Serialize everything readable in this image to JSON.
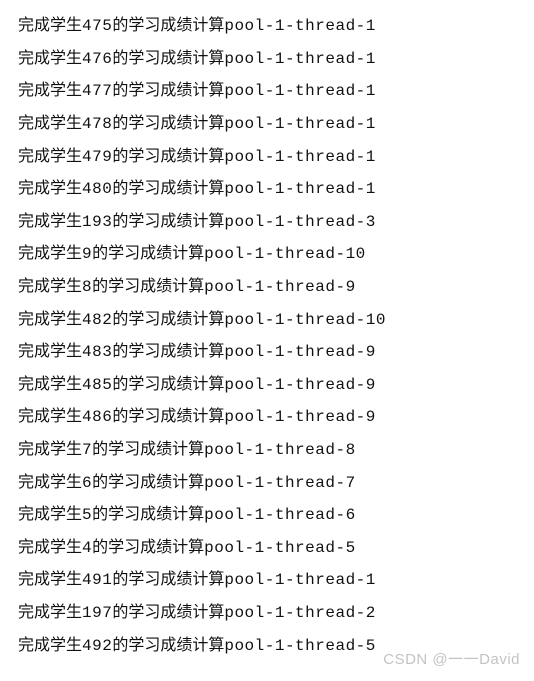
{
  "log_template": {
    "prefix": "完成学生",
    "middle": "的学习成绩计算",
    "pool_prefix": "pool-1-thread-"
  },
  "log_entries": [
    {
      "student": "475",
      "thread": "1"
    },
    {
      "student": "476",
      "thread": "1"
    },
    {
      "student": "477",
      "thread": "1"
    },
    {
      "student": "478",
      "thread": "1"
    },
    {
      "student": "479",
      "thread": "1"
    },
    {
      "student": "480",
      "thread": "1"
    },
    {
      "student": "193",
      "thread": "3"
    },
    {
      "student": "9",
      "thread": "10"
    },
    {
      "student": "8",
      "thread": "9"
    },
    {
      "student": "482",
      "thread": "10"
    },
    {
      "student": "483",
      "thread": "9"
    },
    {
      "student": "485",
      "thread": "9"
    },
    {
      "student": "486",
      "thread": "9"
    },
    {
      "student": "7",
      "thread": "8"
    },
    {
      "student": "6",
      "thread": "7"
    },
    {
      "student": "5",
      "thread": "6"
    },
    {
      "student": "4",
      "thread": "5"
    },
    {
      "student": "491",
      "thread": "1"
    },
    {
      "student": "197",
      "thread": "2"
    },
    {
      "student": "492",
      "thread": "5"
    }
  ],
  "watermark": "CSDN @一一David"
}
